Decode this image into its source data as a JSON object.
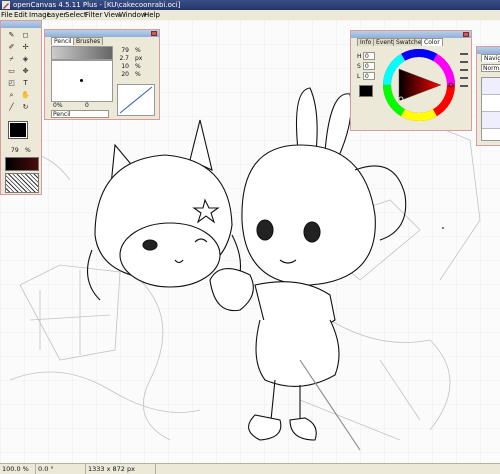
{
  "window": {
    "title": "openCanvas 4.5.11 Plus - [KU\\cakecoonrabi.oci]"
  },
  "menu": [
    "File",
    "Edit",
    "Image",
    "Layer",
    "Select",
    "Filter",
    "View",
    "Window",
    "Help"
  ],
  "toolbox": {
    "tools": [
      "pen-tool",
      "eraser-tool",
      "brush-tool",
      "airbrush-tool",
      "dropper-tool",
      "fill-tool",
      "select-tool",
      "move-tool",
      "text-tool",
      "zoom-tool",
      "hand-tool",
      "line-tool"
    ],
    "fg_color": "#000000",
    "bg_color": "#ffffff",
    "opacity": "79",
    "opacity_unit": "%"
  },
  "brush_panel": {
    "tabs": [
      "Pencil",
      "Brushes"
    ],
    "size_value": "79",
    "size_unit": "%",
    "width_value": "2.7",
    "width_unit": "px",
    "min_value": "10",
    "min_unit": "%",
    "density_value": "20",
    "density_unit": "%",
    "slider_min": "0%",
    "slider_max": "0",
    "tool_name": "Pencil"
  },
  "color_panel": {
    "tabs": [
      "Info",
      "Event",
      "Swatches",
      "Color"
    ],
    "h_label": "H",
    "h_value": "0",
    "s_label": "S",
    "s_value": "0",
    "l_label": "L",
    "l_value": "0",
    "fg_color": "#000000",
    "bg_color": "#ffffff"
  },
  "navigator_panel": {
    "tab": "Navig",
    "blend_mode": "Normal"
  },
  "status": {
    "zoom": "100.0 %",
    "rotation": "0.0 °",
    "size": "1333 x 872 px"
  },
  "colors": {
    "titlebar": "#2a3d75",
    "panel_bg": "#ece9d8",
    "panel_border_pink": "#f2c7c7",
    "hue_ring": "#ff0000"
  }
}
